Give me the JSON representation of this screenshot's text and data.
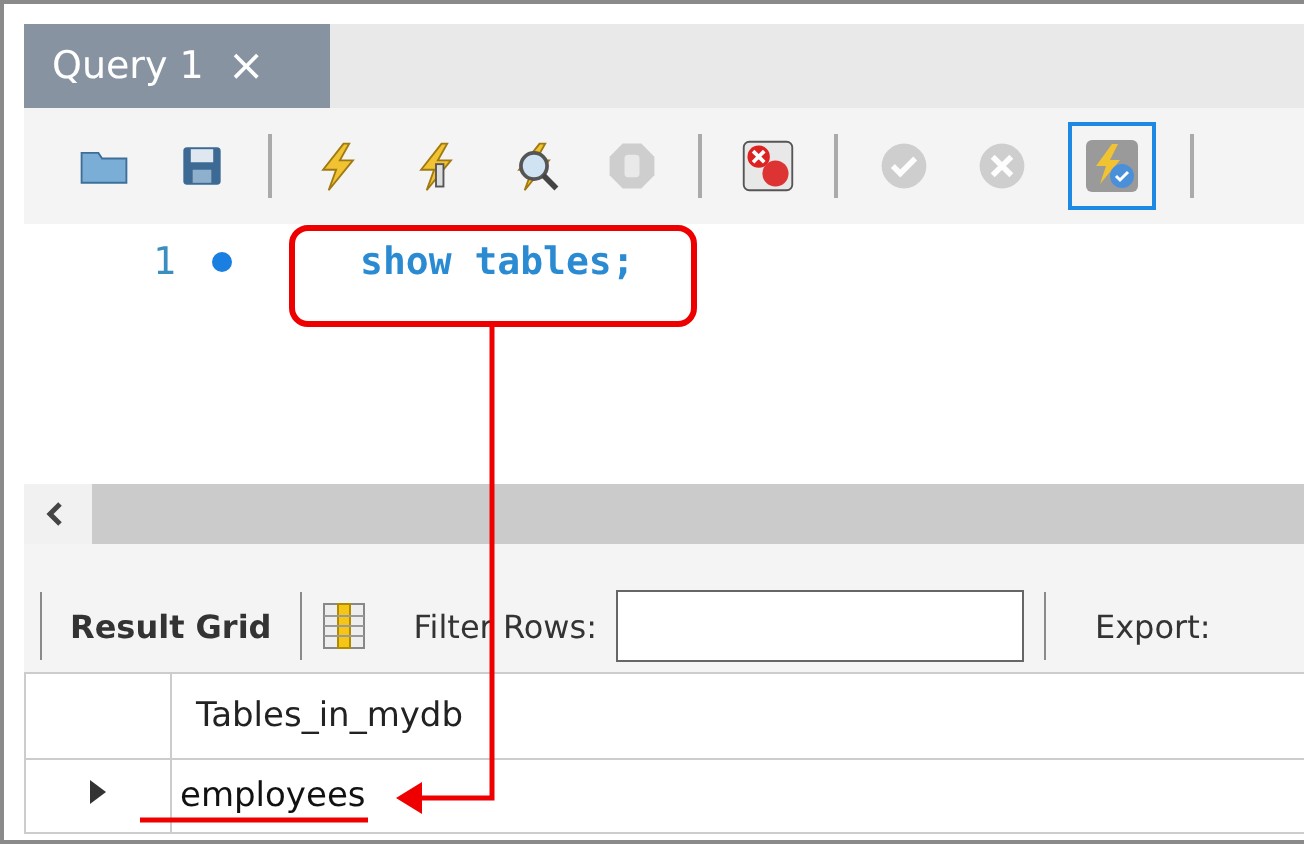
{
  "tab": {
    "title": "Query 1",
    "close": "×"
  },
  "toolbar": [
    {
      "kind": "folder",
      "disabled": false,
      "on": false
    },
    {
      "kind": "save",
      "disabled": false,
      "on": false
    },
    {
      "kind": "sep"
    },
    {
      "kind": "execute",
      "disabled": false,
      "on": false
    },
    {
      "kind": "execute-current",
      "disabled": false,
      "on": false
    },
    {
      "kind": "explain",
      "disabled": false,
      "on": false
    },
    {
      "kind": "stop",
      "disabled": true,
      "on": false
    },
    {
      "kind": "sep"
    },
    {
      "kind": "stop-on-error",
      "disabled": false,
      "on": false
    },
    {
      "kind": "sep"
    },
    {
      "kind": "commit",
      "disabled": true,
      "on": false
    },
    {
      "kind": "rollback",
      "disabled": true,
      "on": false
    },
    {
      "kind": "autocommit",
      "disabled": false,
      "on": true
    },
    {
      "kind": "sep"
    }
  ],
  "editor": {
    "lines": [
      {
        "number": "1",
        "breakpoint": true,
        "code": "show tables;"
      }
    ]
  },
  "result_toolbar": {
    "tab": "Result Grid",
    "filter_label": "Filter Rows:",
    "export_label": "Export:"
  },
  "grid": {
    "columns": [
      "Tables_in_mydb"
    ],
    "rows": [
      {
        "current": true,
        "cells": [
          "employees"
        ]
      }
    ]
  }
}
